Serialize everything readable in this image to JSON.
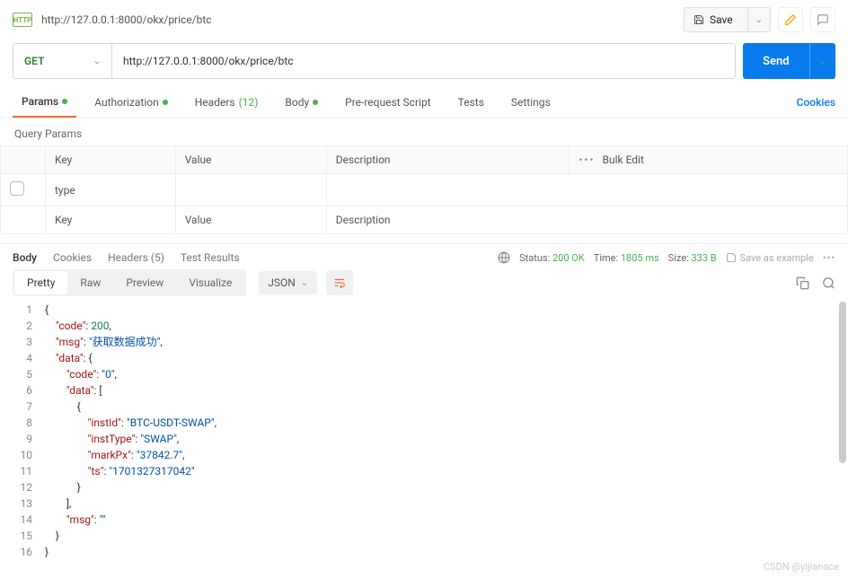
{
  "header": {
    "badge": "HTTP",
    "title": "http://127.0.0.1:8000/okx/price/btc",
    "save_label": "Save"
  },
  "request": {
    "method": "GET",
    "url": "http://127.0.0.1:8000/okx/price/btc",
    "send_label": "Send"
  },
  "tabs": {
    "params": "Params",
    "auth": "Authorization",
    "headers": "Headers",
    "headers_count": "(12)",
    "body": "Body",
    "prereq": "Pre-request Script",
    "tests": "Tests",
    "settings": "Settings",
    "cookies": "Cookies"
  },
  "query": {
    "title": "Query Params",
    "cols": {
      "key": "Key",
      "value": "Value",
      "desc": "Description",
      "bulk": "Bulk Edit"
    },
    "rows": [
      {
        "key": "type",
        "value": "",
        "desc": ""
      }
    ],
    "placeholder": {
      "key": "Key",
      "value": "Value",
      "desc": "Description"
    }
  },
  "response": {
    "tabs": {
      "body": "Body",
      "cookies": "Cookies",
      "headers": "Headers",
      "headers_count": "(5)",
      "tests": "Test Results"
    },
    "status_label": "Status:",
    "status_val": "200 OK",
    "time_label": "Time:",
    "time_val": "1805 ms",
    "size_label": "Size:",
    "size_val": "333 B",
    "save_example": "Save as example",
    "view": {
      "pretty": "Pretty",
      "raw": "Raw",
      "preview": "Preview",
      "visualize": "Visualize",
      "format": "JSON"
    },
    "lines": 16
  },
  "chart_data": {
    "type": "table",
    "note": "JSON response body shown in editor",
    "json": {
      "code": 200,
      "msg": "获取数据成功",
      "data": {
        "code": "0",
        "data": [
          {
            "instId": "BTC-USDT-SWAP",
            "instType": "SWAP",
            "markPx": "37842.7",
            "ts": "1701327317042"
          }
        ],
        "msg": ""
      }
    }
  },
  "watermark": "CSDN @yijianace"
}
